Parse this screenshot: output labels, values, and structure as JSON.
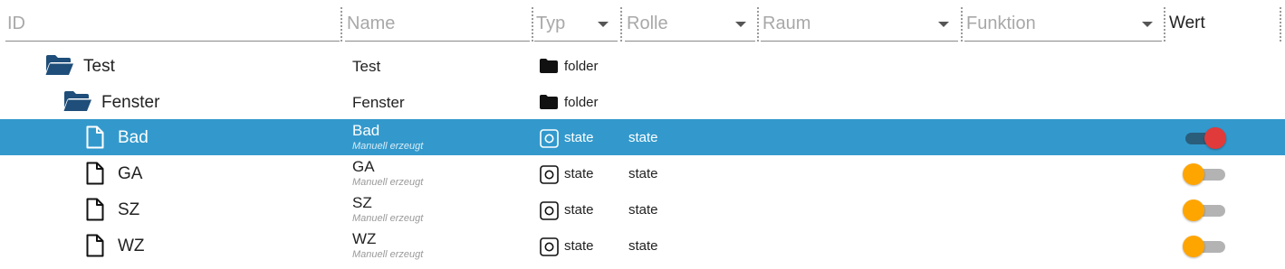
{
  "columns": {
    "id_placeholder": "ID",
    "name_placeholder": "Name",
    "typ": "Typ",
    "rolle": "Rolle",
    "raum": "Raum",
    "funktion": "Funktion",
    "wert": "Wert"
  },
  "rows": [
    {
      "label": "Test",
      "name": "Test",
      "type": "folder",
      "role": "",
      "icon": "folder-open-icon",
      "type_icon": "folder-icon"
    },
    {
      "label": "Fenster",
      "name": "Fenster",
      "type": "folder",
      "role": "",
      "icon": "folder-open-icon",
      "type_icon": "folder-icon"
    },
    {
      "label": "Bad",
      "name": "Bad",
      "subtitle": "Manuell erzeugt",
      "type": "state",
      "role": "state",
      "icon": "file-icon",
      "type_icon": "state-icon",
      "value": true,
      "selected": true
    },
    {
      "label": "GA",
      "name": "GA",
      "subtitle": "Manuell erzeugt",
      "type": "state",
      "role": "state",
      "icon": "file-icon",
      "type_icon": "state-icon",
      "value": false
    },
    {
      "label": "SZ",
      "name": "SZ",
      "subtitle": "Manuell erzeugt",
      "type": "state",
      "role": "state",
      "icon": "file-icon",
      "type_icon": "state-icon",
      "value": false
    },
    {
      "label": "WZ",
      "name": "WZ",
      "subtitle": "Manuell erzeugt",
      "type": "state",
      "role": "state",
      "icon": "file-icon",
      "type_icon": "state-icon",
      "value": false
    }
  ],
  "colors": {
    "selected_row": "#3399cc",
    "folder_icon": "#1e4e79",
    "toggle_off_knob": "#ffa500",
    "toggle_on_knob": "#e03a3a"
  }
}
